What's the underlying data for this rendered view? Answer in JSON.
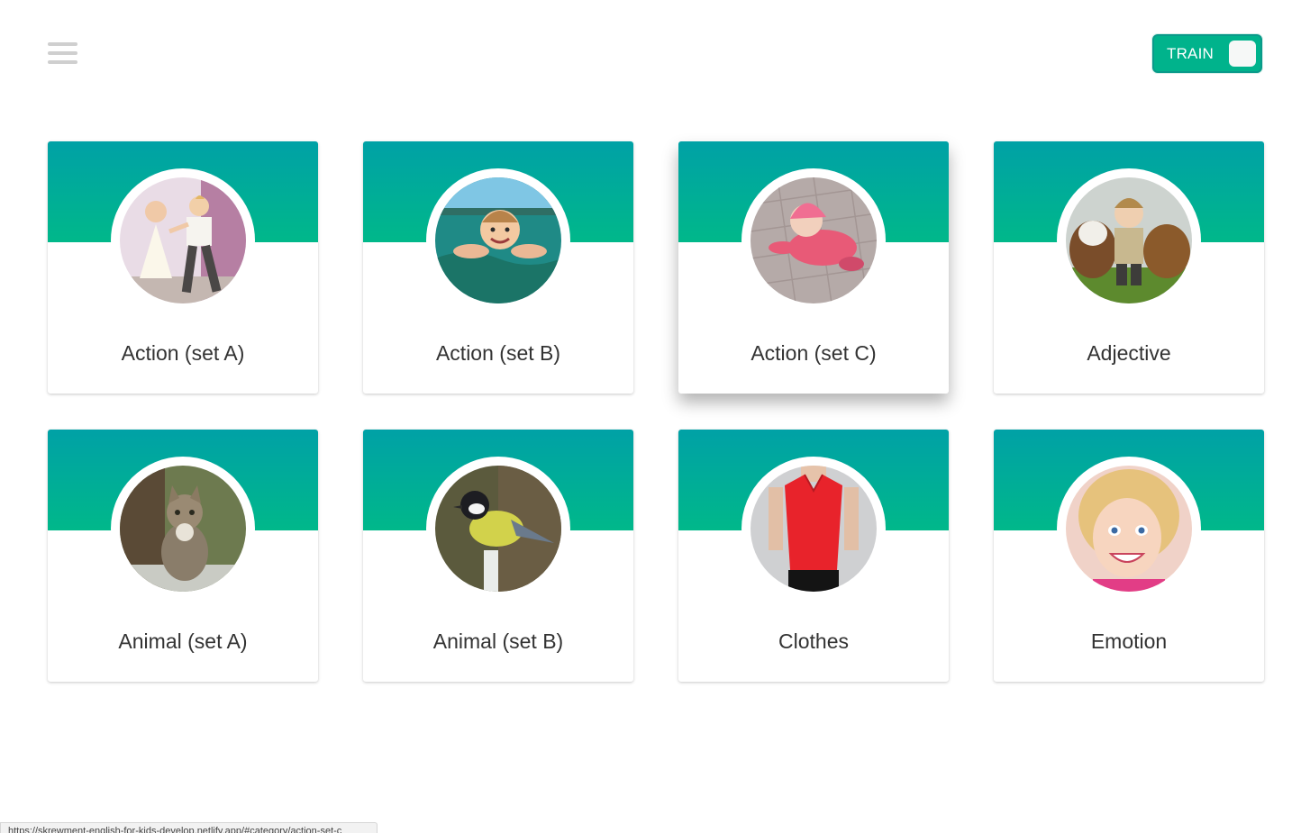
{
  "header": {
    "menu_icon": "hamburger-menu-icon",
    "toggle_label": "TRAIN",
    "toggle_color": "#00b38c"
  },
  "categories": [
    {
      "label": "Action (set A)",
      "image": "kids-dancing-photo"
    },
    {
      "label": "Action (set B)",
      "image": "child-swimming-photo"
    },
    {
      "label": "Action (set C)",
      "image": "baby-crawling-photo"
    },
    {
      "label": "Adjective",
      "image": "boy-with-dogs-photo"
    },
    {
      "label": "Animal (set A)",
      "image": "cat-photo"
    },
    {
      "label": "Animal (set B)",
      "image": "bird-photo"
    },
    {
      "label": "Clothes",
      "image": "red-blouse-photo"
    },
    {
      "label": "Emotion",
      "image": "smiling-girl-photo"
    }
  ],
  "theme": {
    "band_top": "#00a1a6",
    "band_bottom": "#00b88a",
    "text": "#333333"
  },
  "status": {
    "url": "https://skrewment-english-for-kids-develop.netlify.app/#category/action-set-c"
  }
}
